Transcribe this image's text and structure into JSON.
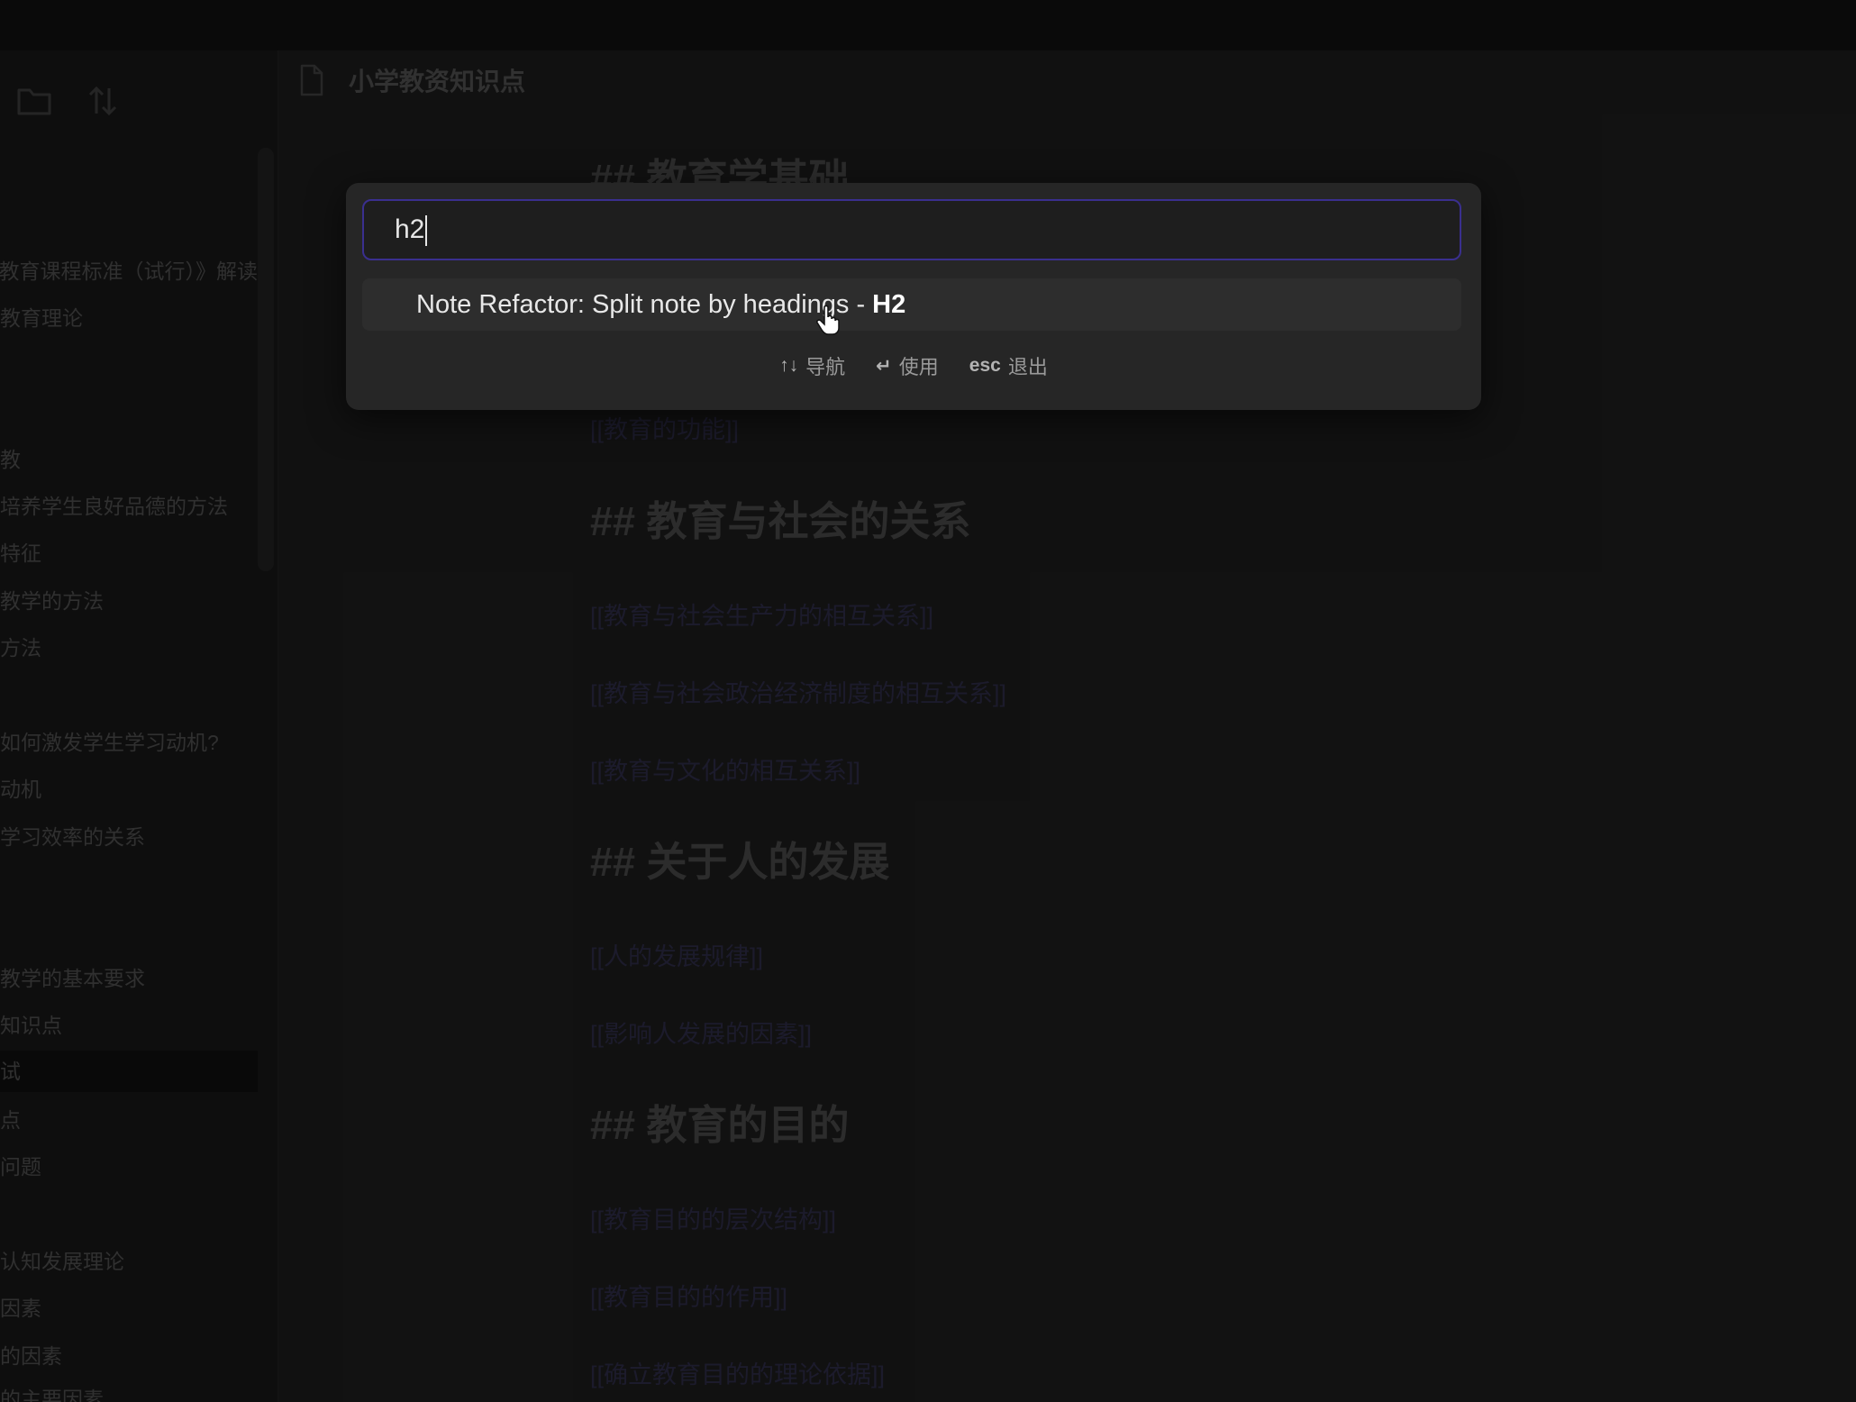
{
  "note": {
    "title": "小学教资知识点"
  },
  "sidebar": {
    "items": [
      {
        "label": "《义务教育课程标准（试行）》解读"
      },
      {
        "label": "教育理论"
      },
      {
        "label": "教"
      },
      {
        "label": "培养学生良好品德的方法"
      },
      {
        "label": "特征"
      },
      {
        "label": "教学的方法"
      },
      {
        "label": "方法"
      },
      {
        "label": "如何激发学生学习动机?"
      },
      {
        "label": "动机"
      },
      {
        "label": "学习效率的关系"
      },
      {
        "label": "教学的基本要求"
      },
      {
        "label": "知识点"
      },
      {
        "label": "试"
      },
      {
        "label": "点"
      },
      {
        "label": "问题"
      },
      {
        "label": "认知发展理论"
      },
      {
        "label": "因素"
      },
      {
        "label": "的因素"
      },
      {
        "label": "的主要因素"
      }
    ]
  },
  "editor": {
    "sections": [
      {
        "heading": "## 教育学基础",
        "links": [
          "[[教育的功能]]"
        ]
      },
      {
        "heading": "## 教育与社会的关系",
        "links": [
          "[[教育与社会生产力的相互关系]]",
          "[[教育与社会政治经济制度的相互关系]]",
          "[[教育与文化的相互关系]]"
        ]
      },
      {
        "heading": "## 关于人的发展",
        "links": [
          "[[人的发展规律]]",
          "[[影响人发展的因素]]"
        ]
      },
      {
        "heading": "## 教育的目的",
        "links": [
          "[[教育目的的层次结构]]",
          "[[教育目的的作用]]",
          "[[确立教育目的的理论依据]]"
        ]
      }
    ]
  },
  "palette": {
    "query": "h2",
    "suggestion_prefix": "Note Refactor: Split note by headings - ",
    "suggestion_bold": "H2",
    "hints": [
      {
        "key": "↑↓",
        "label": "导航"
      },
      {
        "key": "↵",
        "label": "使用"
      },
      {
        "key": "esc",
        "label": "退出"
      }
    ]
  }
}
